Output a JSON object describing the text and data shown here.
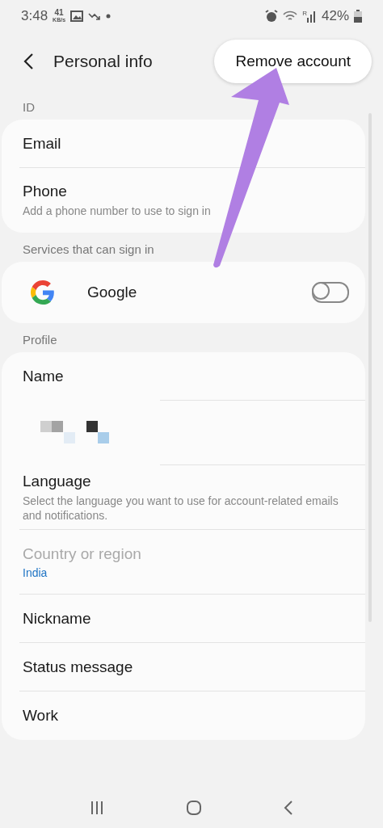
{
  "status_bar": {
    "time": "3:48",
    "speed_value": "41",
    "speed_unit": "KB/s",
    "roaming": "R",
    "battery": "42%"
  },
  "header": {
    "title": "Personal info",
    "action": "Remove account"
  },
  "sections": [
    {
      "title": "ID",
      "items": [
        {
          "kind": "text",
          "label": "Email"
        },
        {
          "kind": "text",
          "label": "Phone",
          "subtitle": "Add a phone number to use to sign in"
        }
      ]
    },
    {
      "title": "Services that can sign in",
      "items": [
        {
          "kind": "toggle",
          "label": "Google",
          "on": false
        }
      ]
    },
    {
      "title": "Profile",
      "items": [
        {
          "kind": "text",
          "label": "Name",
          "short_divider": true
        },
        {
          "kind": "redacted",
          "short_divider": true
        },
        {
          "kind": "text",
          "label": "Language",
          "subtitle": "Select the language you want to use for account-related emails and notifications."
        },
        {
          "kind": "text",
          "label": "Country or region",
          "value": "India",
          "disabled": true
        },
        {
          "kind": "text",
          "label": "Nickname"
        },
        {
          "kind": "text",
          "label": "Status message"
        },
        {
          "kind": "text",
          "label": "Work"
        }
      ]
    }
  ]
}
